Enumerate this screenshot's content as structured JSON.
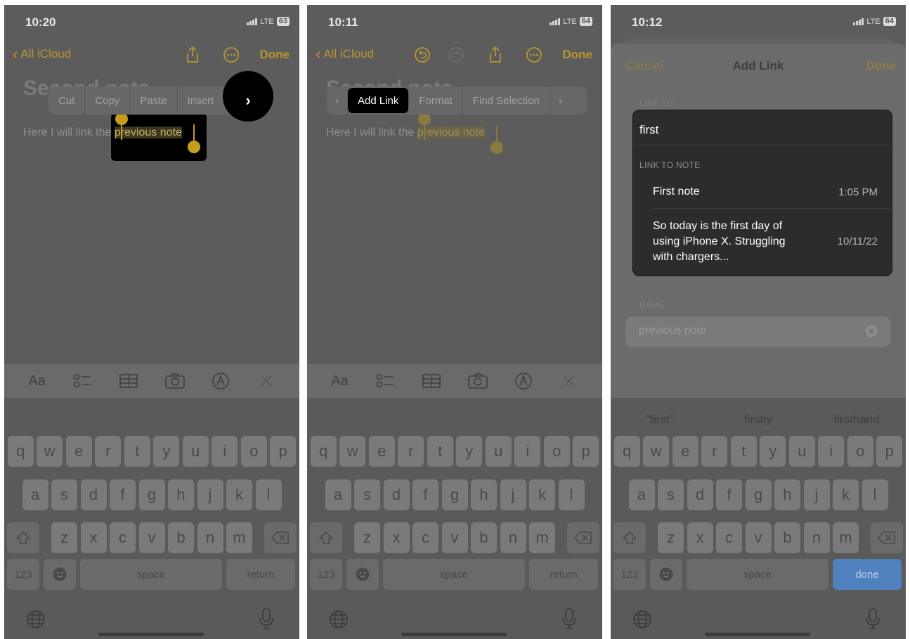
{
  "status": {
    "p1": {
      "time": "10:20",
      "network": "LTE",
      "battery": "63"
    },
    "p2": {
      "time": "10:11",
      "network": "LTE",
      "battery": "64"
    },
    "p3": {
      "time": "10:12",
      "network": "LTE",
      "battery": "64"
    }
  },
  "nav": {
    "back_label": "All iCloud",
    "done_label": "Done"
  },
  "note": {
    "title": "Second note",
    "body_prefix": "Here I will link the ",
    "body_selected": "previous note"
  },
  "edit_menu_1": {
    "items": [
      "Cut",
      "Copy",
      "Paste",
      "Insert"
    ],
    "more": "›"
  },
  "edit_menu_2": {
    "prev": "‹",
    "items": [
      "Add Link",
      "Format",
      "Find Selection"
    ],
    "next": "›"
  },
  "toolbar": {
    "format_label": "Aa"
  },
  "add_link": {
    "cancel_label": "Cancel",
    "title": "Add Link",
    "done_label": "Done",
    "link_to_label": "LINK TO",
    "link_to_value": "first",
    "link_to_note_label": "LINK TO NOTE",
    "results": [
      {
        "title": "First note",
        "date": "1:05 PM"
      },
      {
        "title": "So today is the first day of using iPhone X. Struggling with chargers...",
        "title_lines": [
          "So today is the first day of",
          "using iPhone X. Struggling",
          "with chargers..."
        ],
        "date": "10/11/22"
      }
    ],
    "name_label": "NAME",
    "name_value": "previous note"
  },
  "suggestions": [
    "“first”",
    "firstly",
    "firsthand"
  ],
  "keyboard": {
    "row1": [
      "q",
      "w",
      "e",
      "r",
      "t",
      "y",
      "u",
      "i",
      "o",
      "p"
    ],
    "row2": [
      "a",
      "s",
      "d",
      "f",
      "g",
      "h",
      "j",
      "k",
      "l"
    ],
    "row3": [
      "z",
      "x",
      "c",
      "v",
      "b",
      "n",
      "m"
    ],
    "num_label": "123",
    "space_label": "space",
    "return_label": "return",
    "done_label": "done"
  },
  "colors": {
    "accent": "#b8962e",
    "selection_handle": "#c79e1a",
    "done_key": "#4f81bf"
  }
}
